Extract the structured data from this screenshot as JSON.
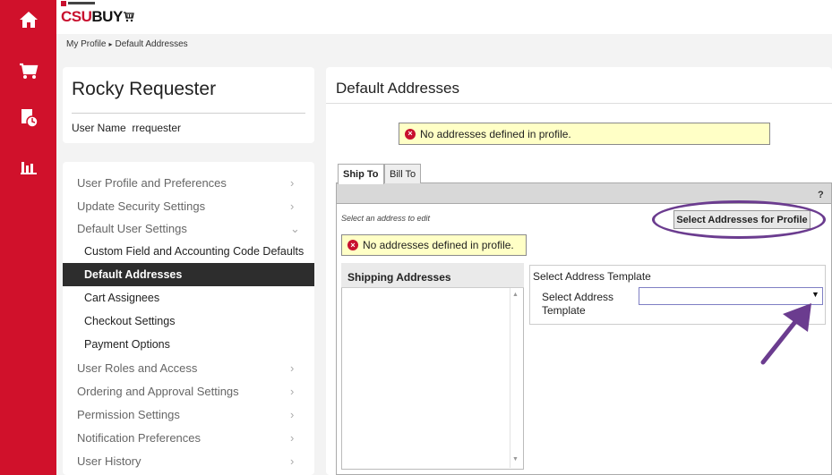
{
  "rail": {
    "items": [
      {
        "icon": "home-icon"
      },
      {
        "icon": "cart-icon"
      },
      {
        "icon": "document-clock-icon"
      },
      {
        "icon": "bar-chart-icon"
      }
    ]
  },
  "header": {
    "logo_primary": "CSU",
    "logo_secondary": "BUY",
    "logo_icon": "cart-icon"
  },
  "breadcrumb": {
    "items": [
      "My Profile",
      "Default Addresses"
    ],
    "separator": "▸"
  },
  "user": {
    "name": "Rocky Requester",
    "username_label": "User Name",
    "username_value": "rrequester"
  },
  "menu": {
    "items": [
      {
        "label": "User Profile and Preferences",
        "chevron": "›"
      },
      {
        "label": "Update Security Settings",
        "chevron": "›"
      },
      {
        "label": "Default User Settings",
        "chevron": "⌄"
      },
      {
        "label": "Custom Field and Accounting Code Defaults"
      },
      {
        "label": "Default Addresses"
      },
      {
        "label": "Cart Assignees"
      },
      {
        "label": "Checkout Settings"
      },
      {
        "label": "Payment Options"
      },
      {
        "label": "User Roles and Access",
        "chevron": "›"
      },
      {
        "label": "Ordering and Approval Settings",
        "chevron": "›"
      },
      {
        "label": "Permission Settings",
        "chevron": "›"
      },
      {
        "label": "Notification Preferences",
        "chevron": "›"
      },
      {
        "label": "User History",
        "chevron": "›"
      }
    ]
  },
  "panel": {
    "title": "Default Addresses",
    "alert_top": "No addresses defined in profile.",
    "tabs": [
      "Ship To",
      "Bill To"
    ],
    "help": "?",
    "select_hint": "Select an address to edit",
    "select_button": "Select Addresses for Profile",
    "alert_inner": "No addresses defined in profile.",
    "list_title": "Shipping Addresses",
    "template_heading": "Select Address Template",
    "template_label": "Select Address Template",
    "template_value": ""
  },
  "colors": {
    "rail": "#d0112b",
    "active_menu": "#2d2d2d",
    "alert_bg": "#ffffc6",
    "annotation": "#6b3c8f"
  }
}
